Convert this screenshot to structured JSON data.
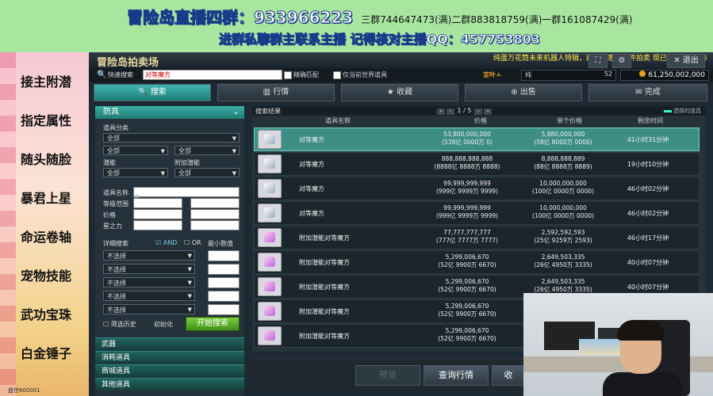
{
  "banner": {
    "line1_main": "冒险岛直播四群：933966223",
    "line1_groups": "三群744647473(满)二群883818759(满)一群161087429(满)",
    "line2": "进群私聊群主联系主播 记得核对主播QQ：457753803"
  },
  "left_panel": {
    "items": [
      "接主附潜",
      "指定属性",
      "随头随脸",
      "暴君上星",
      "命运卷轴",
      "宠物技能",
      "武功宝珠",
      "白金锤子"
    ],
    "credit": "盛世600001"
  },
  "window": {
    "title": "冒险岛拍卖场",
    "marquee": "纯蛋万花筒未来机器人特辑，两合心意的佳件拍卖 现已上架，集齐5",
    "close_label": "退出",
    "close_icon": "close-icon"
  },
  "searchbar": {
    "label": "快速搜索",
    "value": "对等魔方",
    "exact_match_label": "精确匹配",
    "current_world_label": "仅当前世界道具",
    "cash_label": "言叶ㅅ",
    "cash_name": "纯",
    "cash_amount": "52",
    "mesos": "61,250,002,000"
  },
  "tabs": [
    {
      "label": "搜索",
      "icon": "search-icon"
    },
    {
      "label": "行情",
      "icon": "chart-icon"
    },
    {
      "label": "收藏",
      "icon": "star-icon"
    },
    {
      "label": "出售",
      "icon": "sell-icon"
    },
    {
      "label": "完成",
      "icon": "check-icon"
    }
  ],
  "filter": {
    "header": "防具",
    "item_category_label": "道具分类",
    "category_value": "全部",
    "sub1": "全部",
    "sub2": "全部",
    "potential_label": "潜能",
    "add_potential_label": "附加潜能",
    "pot_value": "全部",
    "add_pot_value": "全部",
    "item_name_label": "道具名称",
    "level_range_label": "等级范围",
    "price_label": "价格",
    "star_label": "星之力",
    "detail_search_label": "详细搜索",
    "and_label": "AND",
    "or_label": "OR",
    "min_value_label": "最小数值",
    "options": [
      "不选择",
      "不选择",
      "不选择",
      "不选择",
      "不选择"
    ],
    "history_label": "筛选历史",
    "reset_label": "初始化",
    "start_label": "开始搜索",
    "categories": [
      "武器",
      "消耗道具",
      "商城道具",
      "其他道具"
    ]
  },
  "results": {
    "title": "搜索结果",
    "page_current": "1",
    "page_total": "5",
    "selected_items_label": "选择的道具",
    "columns": {
      "name": "道具名称",
      "price": "价格",
      "unit_price": "单个价格",
      "time_left": "剩余时间"
    },
    "rows": [
      {
        "name": "对等魔方",
        "price": "53,800,000,000",
        "price_sub": "(538亿 0000万 0)",
        "unit": "5,880,000,000",
        "unit_sub": "(58亿 8000万 0000)",
        "time": "41小时31分钟",
        "icon": "cube-icon"
      },
      {
        "name": "对等魔方",
        "price": "888,888,888,888",
        "price_sub": "(8888亿 8888万 8888)",
        "unit": "8,888,888,889",
        "unit_sub": "(88亿 8888万 8889)",
        "time": "19小时10分钟",
        "icon": "cube-icon"
      },
      {
        "name": "对等魔方",
        "price": "99,999,999,999",
        "price_sub": "(999亿 9999万 9999)",
        "unit": "10,000,000,000",
        "unit_sub": "(100亿 0000万 0000)",
        "time": "46小时02分钟",
        "icon": "cube-icon"
      },
      {
        "name": "对等魔方",
        "price": "99,999,999,999",
        "price_sub": "(999亿 9999万 9999)",
        "unit": "10,000,000,000",
        "unit_sub": "(100亿 0000万 0000)",
        "time": "46小时02分钟",
        "icon": "cube-icon"
      },
      {
        "name": "附加潜能对等魔方",
        "price": "77,777,777,777",
        "price_sub": "(777亿 7777万 7777)",
        "unit": "2,592,592,593",
        "unit_sub": "(25亿 9259万 2593)",
        "time": "46小时17分钟",
        "icon": "cube-purple-icon"
      },
      {
        "name": "附加潜能对等魔方",
        "price": "5,299,006,670",
        "price_sub": "(52亿 9900万 6670)",
        "unit": "2,649,503,335",
        "unit_sub": "(26亿 4950万 3335)",
        "time": "40小时07分钟",
        "icon": "cube-purple-icon"
      },
      {
        "name": "附加潜能对等魔方",
        "price": "5,299,006,670",
        "price_sub": "(52亿 9900万 6670)",
        "unit": "2,649,503,335",
        "unit_sub": "(26亿 4950万 3335)",
        "time": "40小时07分钟",
        "icon": "cube-purple-icon"
      },
      {
        "name": "附加潜能对等魔方",
        "price": "5,299,006,670",
        "price_sub": "(52亿 9900万 6670)",
        "unit": "",
        "unit_sub": "",
        "time": "",
        "icon": "cube-purple-icon"
      },
      {
        "name": "附加潜能对等魔方",
        "price": "5,299,006,670",
        "price_sub": "(52亿 9900万 6670)",
        "unit": "",
        "unit_sub": "",
        "time": "",
        "icon": "cube-purple-icon"
      }
    ]
  },
  "bottom": {
    "preview_label": "预览",
    "query_label": "查询行情",
    "collect_label": "收"
  }
}
